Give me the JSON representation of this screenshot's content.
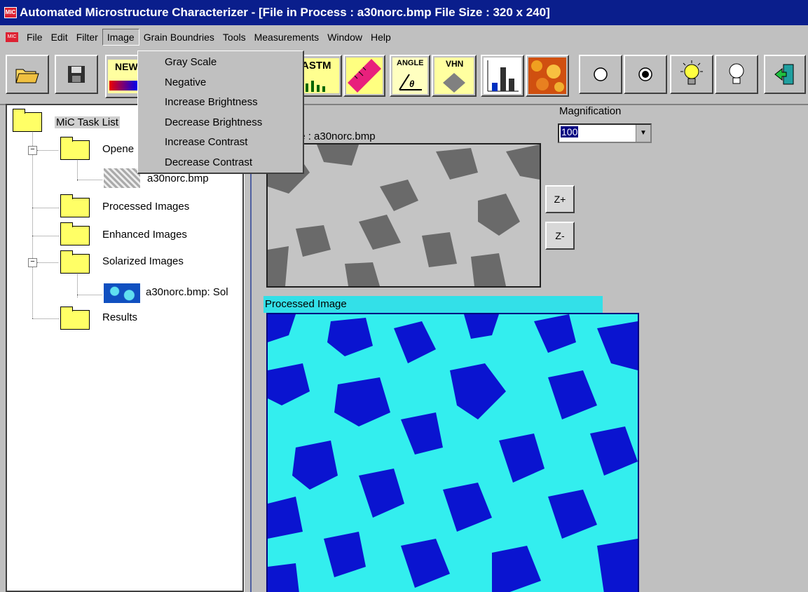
{
  "window": {
    "title": "Automated Microstructure Characterizer - [File in Process : a30norc.bmp  File Size : 320 x 240]"
  },
  "menubar": {
    "items": [
      "File",
      "Edit",
      "Filter",
      "Image",
      "Grain Boundries",
      "Tools",
      "Measurements",
      "Window",
      "Help"
    ]
  },
  "image_menu": {
    "items": [
      "Gray Scale",
      "Negative",
      "Increase Brightness",
      "Decrease Brightness",
      "Increase Contrast",
      "Decrease Contrast"
    ]
  },
  "toolbar": {
    "new_label": "NEW",
    "astm_label": "ASTM",
    "angle_label": "ANGLE",
    "vhn_label": "VHN"
  },
  "tree": {
    "root": "MiC Task List",
    "opened": "Opene",
    "opened_file": "a30norc.bmp",
    "processed": "Processed Images",
    "enhanced": "Enhanced Images",
    "solarized": "Solarized Images",
    "solarized_file": "a30norc.bmp: Sol",
    "results": "Results"
  },
  "magnification": {
    "label": "Magnification",
    "value": "100"
  },
  "original": {
    "label": "al Image : a30norc.bmp"
  },
  "zoom": {
    "in": "Z+",
    "out": "Z-"
  },
  "processed": {
    "label": "Processed Image"
  },
  "colors": {
    "title_bg": "#0a1e8c",
    "processed_cyan": "#33eeee",
    "processed_blue": "#0a14d0",
    "folder_yellow": "#ffff66"
  }
}
